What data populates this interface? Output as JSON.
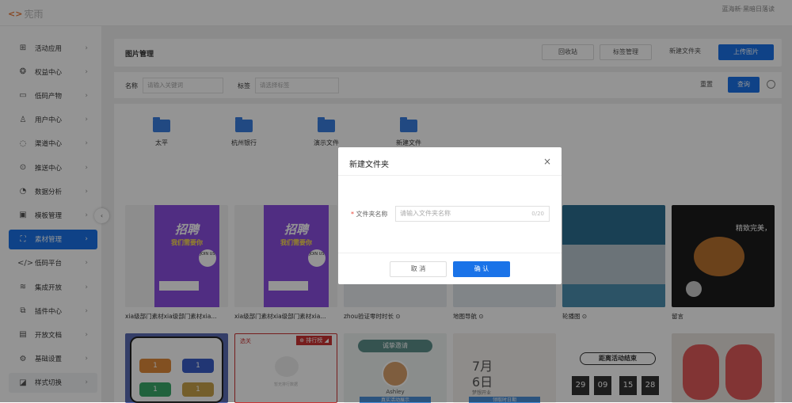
{
  "app": {
    "logo_mark": "<>",
    "title": "宪雨",
    "user_text": "蓝海新·黑暗日落读"
  },
  "sidebar": {
    "items": [
      {
        "label": "活动应用",
        "icon": "⊞",
        "icon_name": "grid-icon"
      },
      {
        "label": "权益中心",
        "icon": "❂",
        "icon_name": "gift-icon"
      },
      {
        "label": "低码产物",
        "icon": "▭",
        "icon_name": "card-icon"
      },
      {
        "label": "用户中心",
        "icon": "♙",
        "icon_name": "user-icon"
      },
      {
        "label": "渠道中心",
        "icon": "◌",
        "icon_name": "channel-icon"
      },
      {
        "label": "推送中心",
        "icon": "⊙",
        "icon_name": "push-icon"
      },
      {
        "label": "数据分析",
        "icon": "◔",
        "icon_name": "chart-icon"
      },
      {
        "label": "模板管理",
        "icon": "▣",
        "icon_name": "template-icon"
      },
      {
        "label": "素材管理",
        "icon": "⛶",
        "icon_name": "image-icon"
      },
      {
        "label": "低码平台",
        "icon": "</>",
        "icon_name": "code-icon"
      },
      {
        "label": "集成开放",
        "icon": "≋",
        "icon_name": "layers-icon"
      },
      {
        "label": "插件中心",
        "icon": "⧉",
        "icon_name": "plugin-icon"
      },
      {
        "label": "开放文档",
        "icon": "▤",
        "icon_name": "document-icon"
      },
      {
        "label": "基础设置",
        "icon": "⚙",
        "icon_name": "settings-icon"
      },
      {
        "label": "样式切换",
        "icon": "◪",
        "icon_name": "style-icon"
      }
    ],
    "arrow": "›",
    "collapse": "‹"
  },
  "header": {
    "title": "图片管理",
    "recycle": "回收站",
    "tags": "标签管理",
    "new_folder": "新建文件夹",
    "upload": "上传图片"
  },
  "filters": {
    "name_label": "名称",
    "name_placeholder": "请输入关键词",
    "tag_label": "标签",
    "tag_placeholder": "请选择标签",
    "reset": "重置",
    "query": "查询"
  },
  "folders": [
    "太平",
    "杭州银行",
    "演示文件",
    "新建文件"
  ],
  "images": [
    {
      "caption": "xia级部门素材xia级部门素材xia...",
      "title": "招聘",
      "sub": "我们需要你",
      "join": "JOIN US"
    },
    {
      "caption": "xia级部门素材xia级部门素材xia...",
      "title": "招聘",
      "sub": "我们需要你",
      "join": "JOIN US"
    },
    {
      "caption": "zhou验证零时时长 ⊙"
    },
    {
      "caption": "地图导航 ⊙"
    },
    {
      "caption": "轮播图 ⊙"
    },
    {
      "caption": "留言",
      "overlay_text": "精致完美，"
    }
  ],
  "row2": {
    "c1": {
      "a": "1",
      "b": "1",
      "c": "1",
      "d": "1"
    },
    "c2": {
      "tag1": "选关",
      "tag2": "⊕ 排行榜 ◢",
      "note": "暂无排行数据"
    },
    "c3": {
      "banner": "诚挚邀请",
      "name": "Ashley",
      "bottom": "真实活动展示"
    },
    "c4": {
      "month": "7月",
      "day": "6日",
      "weekday": "梦想开业",
      "bottom": "领取时日期"
    },
    "c5": {
      "headline": "距离活动结束",
      "d1": "29",
      "d2": "09",
      "d3": "15",
      "d4": "28"
    },
    "c6": {}
  },
  "dialog": {
    "title": "新建文件夹",
    "close": "×",
    "required": "*",
    "label": "文件夹名称",
    "placeholder": "请输入文件夹名称",
    "counter": "0/20",
    "cancel": "取 消",
    "confirm": "确 认"
  },
  "colors": {
    "accent": "#1a73e8",
    "poster": "#8a4ee0"
  }
}
